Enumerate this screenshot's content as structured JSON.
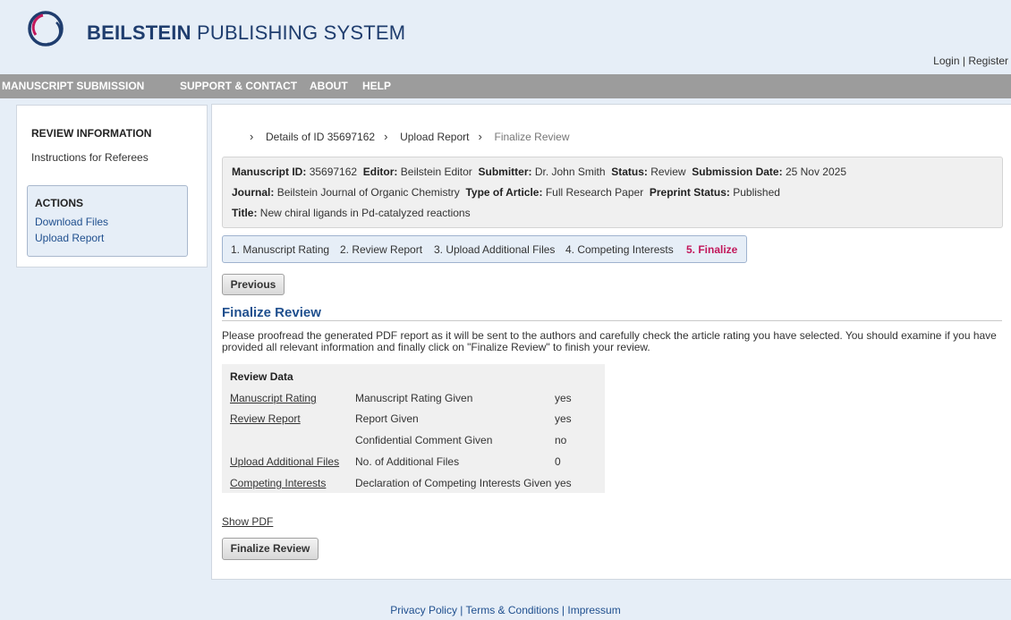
{
  "brand": {
    "bold": "BEILSTEIN",
    "rest": " PUBLISHING SYSTEM"
  },
  "auth": {
    "login": "Login",
    "separator": " | ",
    "register": "Register"
  },
  "nav": [
    "MANUSCRIPT SUBMISSION",
    "SUPPORT & CONTACT",
    "ABOUT",
    "HELP"
  ],
  "sidebar": {
    "heading": "REVIEW INFORMATION",
    "instructions": "Instructions for Referees",
    "actions_title": "ACTIONS",
    "download": "Download Files",
    "upload": "Upload Report"
  },
  "breadcrumb": {
    "item1": "Details of ID 35697162",
    "item2": "Upload Report",
    "current": "Finalize Review"
  },
  "manuscript": {
    "id_label": "Manuscript ID:",
    "id": "35697162",
    "editor_label": "Editor:",
    "editor": "Beilstein Editor",
    "submitter_label": "Submitter:",
    "submitter": "Dr. John Smith",
    "status_label": "Status:",
    "status": "Review",
    "date_label": "Submission Date:",
    "date": "25 Nov 2025",
    "journal_label": "Journal:",
    "journal": "Beilstein Journal of Organic Chemistry",
    "type_label": "Type of Article:",
    "type": "Full Research Paper",
    "preprint_label": "Preprint Status:",
    "preprint": "Published",
    "title_label": "Title:",
    "title": "New chiral ligands in Pd-catalyzed reactions"
  },
  "steps": [
    "1. Manuscript Rating",
    "2. Review Report",
    "3. Upload Additional Files",
    "4. Competing Interests",
    "5. Finalize"
  ],
  "buttons": {
    "previous": "Previous",
    "finalize": "Finalize Review"
  },
  "section": {
    "title": "Finalize Review",
    "description": "Please proofread the generated PDF report as it will be sent to the authors and carefully check the article rating you have selected. You should examine if you have provided all relevant information and finally click on \"Finalize Review\" to finish your review."
  },
  "review_data": {
    "heading": "Review Data",
    "rows": [
      {
        "link": "Manuscript Rating",
        "label": "Manuscript Rating Given",
        "value": "yes"
      },
      {
        "link": "Review Report",
        "label": "Report Given",
        "value": "yes"
      },
      {
        "link": "",
        "label": "Confidential Comment Given",
        "value": "no"
      },
      {
        "link": "Upload Additional Files",
        "label": "No. of Additional Files",
        "value": "0"
      },
      {
        "link": "Competing Interests",
        "label": "Declaration of Competing Interests Given",
        "value": "yes"
      }
    ]
  },
  "show_pdf": "Show PDF",
  "footer": {
    "privacy": "Privacy Policy",
    "terms": "Terms & Conditions",
    "impressum": "Impressum",
    "separator": " | "
  },
  "colors": {
    "navy": "#1f3d6e",
    "link": "#1f4f8e",
    "active_step": "#c2185b",
    "nav_bar": "#9c9c9c",
    "page_bg": "#e6eef7"
  }
}
